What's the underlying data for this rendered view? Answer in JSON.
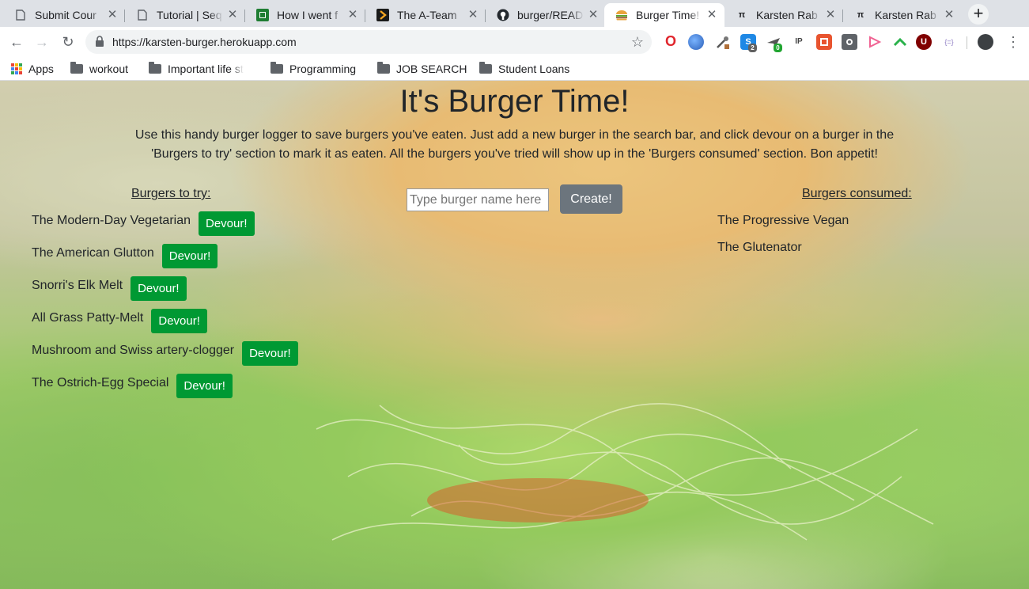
{
  "browser": {
    "tabs": [
      {
        "label": "Submit Cour",
        "icon": "document-icon"
      },
      {
        "label": "Tutorial | Seq",
        "icon": "document-icon"
      },
      {
        "label": "How I went f",
        "icon": "green-app-icon"
      },
      {
        "label": "The A-Team",
        "icon": "a-team-icon"
      },
      {
        "label": "burger/READ",
        "icon": "github-icon"
      },
      {
        "label": "Burger Time!",
        "icon": "burger-icon",
        "active": true
      },
      {
        "label": "Karsten Rab",
        "icon": "pi-icon"
      },
      {
        "label": "Karsten Rab",
        "icon": "pi-icon"
      }
    ],
    "url": "https://karsten-burger.herokuapp.com",
    "extension_badges": {
      "skype": "2",
      "bluecheck": "0",
      "ip": "IP",
      "ublock": "U",
      "braces": "{=}"
    },
    "bookmarks": [
      {
        "label": "Apps",
        "type": "apps"
      },
      {
        "label": "workout",
        "type": "folder"
      },
      {
        "label": "Important life st",
        "type": "folder"
      },
      {
        "label": "Programming",
        "type": "folder"
      },
      {
        "label": "JOB SEARCH",
        "type": "folder"
      },
      {
        "label": "Student Loans",
        "type": "folder"
      }
    ]
  },
  "page": {
    "title": "It's Burger Time!",
    "intro": "Use this handy burger logger to save burgers you've eaten. Just add a new burger in the search bar, and click devour on a burger in the 'Burgers to try' section to mark it as eaten. All the burgers you've tried will show up in the 'Burgers consumed' section. Bon appetit!",
    "to_try_heading": "Burgers to try:",
    "consumed_heading": "Burgers consumed:",
    "input_placeholder": "Type burger name here",
    "create_label": "Create!",
    "devour_label": "Devour!",
    "to_try": [
      "The Modern-Day Vegetarian",
      "The American Glutton",
      "Snorri's Elk Melt",
      "All Grass Patty-Melt",
      "Mushroom and Swiss artery-clogger",
      "The Ostrich-Egg Special"
    ],
    "consumed": [
      "The Progressive Vegan",
      "The Glutenator"
    ]
  },
  "colors": {
    "devour_button": "#009933",
    "create_button": "#6c757d",
    "active_tab": "#ffffff",
    "tab_strip": "#dee1e6"
  }
}
